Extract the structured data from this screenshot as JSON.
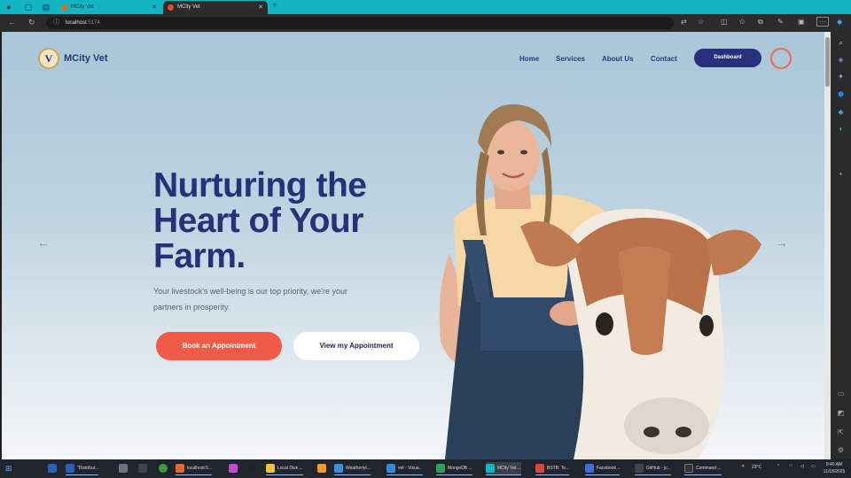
{
  "browser": {
    "tabs": [
      {
        "title": "MCity Vet",
        "active": false
      },
      {
        "title": "MCity Vet",
        "active": true
      }
    ],
    "url_host": "localhost",
    "url_port": ":5174"
  },
  "site": {
    "logo_letter": "V",
    "logo_text": "MCity Vet",
    "nav": [
      "Home",
      "Services",
      "About Us",
      "Contact"
    ],
    "dashboard_label": "Dashboard"
  },
  "hero": {
    "title_lines": [
      "Nurturing the",
      "Heart of Your",
      "Farm."
    ],
    "subtitle_lines": [
      "Your livestock's well-being is our top priority, we're your",
      "partners in prosperity."
    ],
    "book_label": "Book an Appointment",
    "view_label": "View my Appointment",
    "prev_arrow": "←",
    "next_arrow": "→"
  },
  "taskbar": {
    "items": [
      {
        "label": "\"Distribut...",
        "color": "#2b5fb8"
      },
      {
        "label": "localhost:5...",
        "color": "#e26a2c"
      },
      {
        "label": "Local Disk ...",
        "color": "#f1c232"
      },
      {
        "label": "Weatherlyt...",
        "color": "#3c8fe0"
      },
      {
        "label": "vet - Visua...",
        "color": "#2f8ad8"
      },
      {
        "label": "MongoDB ...",
        "color": "#2e9e5b"
      },
      {
        "label": "MCity Vet ...",
        "color": "#12b5c4"
      },
      {
        "label": "BSTB: Te...",
        "color": "#d8483a"
      },
      {
        "label": "Facebook...",
        "color": "#3a6fd8"
      },
      {
        "label": "GitHub - jc...",
        "color": "#444444"
      },
      {
        "label": "Command ...",
        "color": "#333333"
      }
    ],
    "weather": "23°C",
    "time": "9:40 AM",
    "date": "11/18/2025"
  },
  "colors": {
    "brand_navy": "#27307a",
    "accent_coral": "#f05a47",
    "browser_teal": "#12b5c4"
  }
}
